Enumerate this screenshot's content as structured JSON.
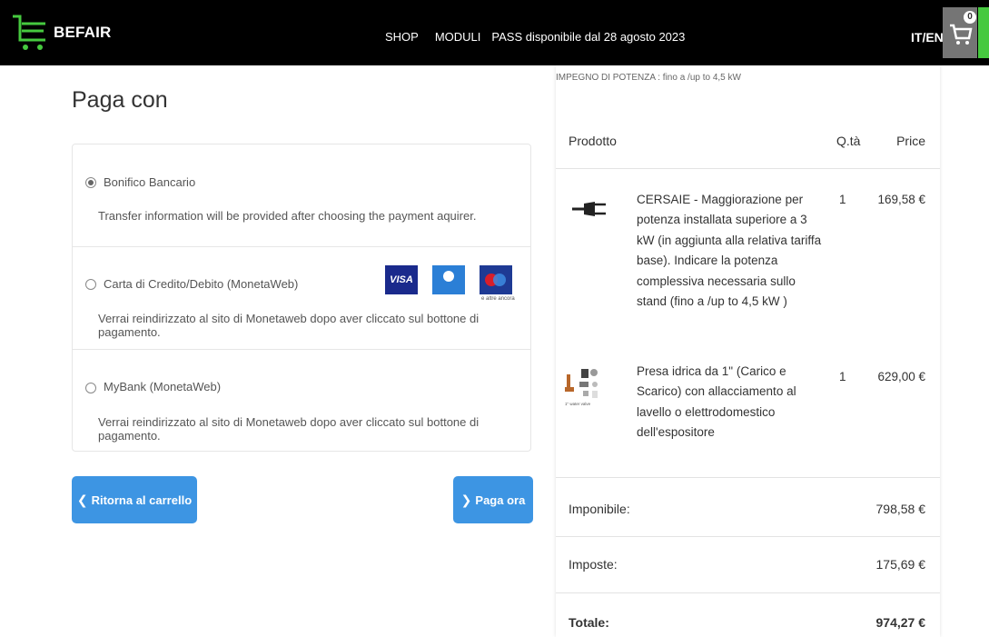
{
  "header": {
    "brand": "BEFAIR",
    "nav": [
      "SHOP",
      "MODULI",
      "PASS disponibile dal 28 agosto 2023"
    ],
    "lang": "IT/EN",
    "cart_count": "0",
    "accent_color": "#46c93f"
  },
  "payment": {
    "title": "Paga con",
    "options": [
      {
        "label": "Bonifico Bancario",
        "description": "Transfer information will be provided after choosing the payment aquirer.",
        "selected": true
      },
      {
        "label": "Carta di Credito/Debito (MonetaWeb)",
        "description": "Verrai reindirizzato al sito di Monetaweb dopo aver cliccato sul bottone di pagamento.",
        "selected": false,
        "cards": [
          "VISA",
          "Diners Club",
          "Maestro"
        ],
        "cards_note": "e altre ancora"
      },
      {
        "label": "MyBank (MonetaWeb)",
        "description": "Verrai reindirizzato al sito di Monetaweb dopo aver cliccato sul bottone di pagamento.",
        "selected": false
      }
    ],
    "back_button": "Ritorna al carrello",
    "pay_button": "Paga ora",
    "button_color": "#3d95e3"
  },
  "order": {
    "top_note": "IMPEGNO DI POTENZA : fino a /up to 4,5 kW",
    "headers": {
      "product": "Prodotto",
      "qty": "Q.tà",
      "price": "Price"
    },
    "items": [
      {
        "icon": "power-plug-icon",
        "name": "CERSAIE - Maggiorazione per potenza installata superiore a 3 kW (in aggiunta alla relativa tariffa base). Indicare la potenza complessiva necessaria sullo stand (fino a /up to 4,5 kW )",
        "qty": "1",
        "price": "169,58 €"
      },
      {
        "icon": "water-valve-icon",
        "icon_caption": "1\" water valve",
        "name": "Presa idrica da 1\" (Carico e Scarico) con allacciamento al lavello o elettrodomestico dell'espositore",
        "qty": "1",
        "price": "629,00 €"
      }
    ],
    "summary": {
      "subtotal_label": "Imponibile:",
      "subtotal": "798,58 €",
      "taxes_label": "Imposte:",
      "taxes": "175,69 €",
      "total_label": "Totale:",
      "total": "974,27 €"
    }
  }
}
